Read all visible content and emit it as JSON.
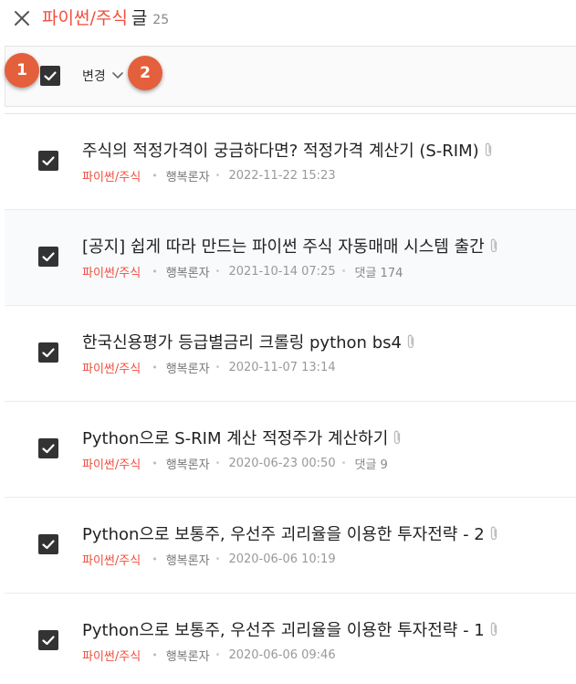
{
  "header": {
    "category": "파이썬/주식",
    "suffix": "글",
    "count": "25"
  },
  "toolbar": {
    "change_label": "변경",
    "select_all_checked": true
  },
  "markers": [
    "1",
    "2"
  ],
  "posts": [
    {
      "title": "주식의 적정가격이 궁금하다면? 적정가격 계산기 (S-RIM)",
      "category": "파이썬/주식",
      "author": "행복론자",
      "date": "2022-11-22 15:23",
      "comments": "",
      "checked": true
    },
    {
      "title": "[공지] 쉽게 따라 만드는 파이썬 주식 자동매매 시스템 출간",
      "category": "파이썬/주식",
      "author": "행복론자",
      "date": "2021-10-14 07:25",
      "comments": "댓글 174",
      "checked": true
    },
    {
      "title": "한국신용평가 등급별금리 크롤링 python bs4",
      "category": "파이썬/주식",
      "author": "행복론자",
      "date": "2020-11-07 13:14",
      "comments": "",
      "checked": true
    },
    {
      "title": "Python으로 S-RIM 계산 적정주가 계산하기",
      "category": "파이썬/주식",
      "author": "행복론자",
      "date": "2020-06-23 00:50",
      "comments": "댓글 9",
      "checked": true
    },
    {
      "title": "Python으로 보통주, 우선주 괴리율을 이용한 투자전략 - 2",
      "category": "파이썬/주식",
      "author": "행복론자",
      "date": "2020-06-06 10:19",
      "comments": "",
      "checked": true
    },
    {
      "title": "Python으로 보통주, 우선주 괴리율을 이용한 투자전략 - 1",
      "category": "파이썬/주식",
      "author": "행복론자",
      "date": "2020-06-06 09:46",
      "comments": "",
      "checked": true
    }
  ],
  "colors": {
    "accent": "#f04e3e",
    "marker": "#e4603c",
    "checkbox": "#333333"
  },
  "icons": {
    "close": "close-icon",
    "chevron": "chevron-down-icon",
    "attachment": "paperclip-icon",
    "check": "check-icon"
  }
}
